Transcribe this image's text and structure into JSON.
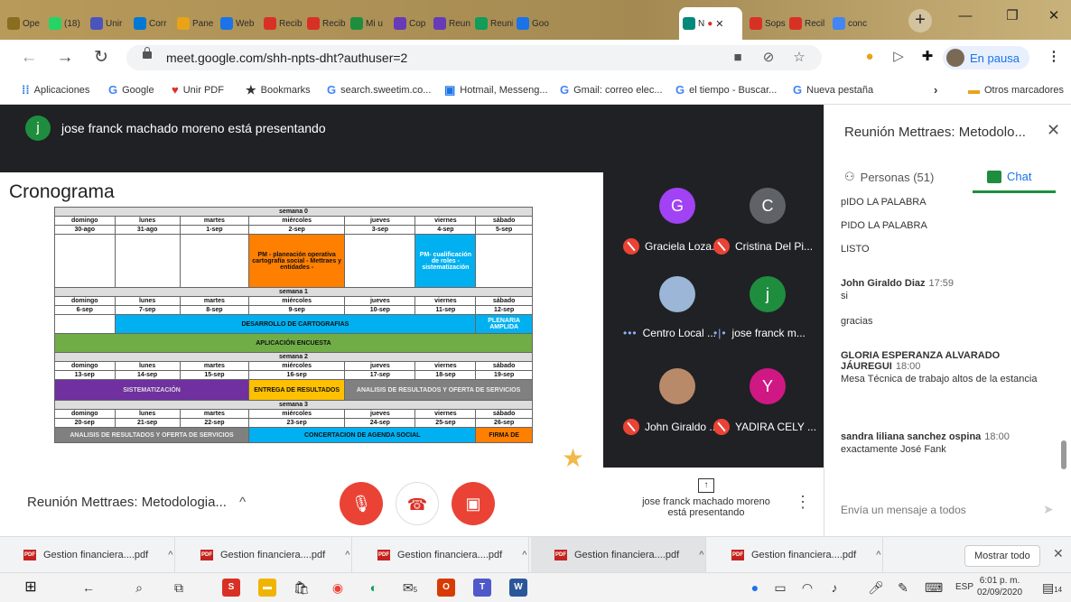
{
  "browser": {
    "tabs": [
      {
        "label": "Ope",
        "icon": "youtube-icon",
        "color": "#8a6d1e"
      },
      {
        "label": "(18) ",
        "icon": "whatsapp-icon",
        "color": "#25d366"
      },
      {
        "label": "Unir",
        "icon": "teams-icon",
        "color": "#4b53bc"
      },
      {
        "label": "Corr",
        "icon": "outlook-icon",
        "color": "#0078d4"
      },
      {
        "label": "Pane",
        "icon": "panel-icon",
        "color": "#e8a317"
      },
      {
        "label": "Web",
        "icon": "web-icon",
        "color": "#1a73e8"
      },
      {
        "label": "Recib",
        "icon": "gmail-icon",
        "color": "#d93025"
      },
      {
        "label": "Recib",
        "icon": "gmail-icon",
        "color": "#d93025"
      },
      {
        "label": "Mi u",
        "icon": "drive-icon",
        "color": "#1e8e3e"
      },
      {
        "label": "Cop",
        "icon": "forms-icon",
        "color": "#673ab7"
      },
      {
        "label": "Reun",
        "icon": "forms-icon",
        "color": "#673ab7"
      },
      {
        "label": "Reuni",
        "icon": "classroom-icon",
        "color": "#0f9d58"
      },
      {
        "label": "Goo",
        "icon": "calendar-icon",
        "color": "#1a73e8"
      },
      {
        "label": "Sops",
        "icon": "gmail-icon",
        "color": "#d93025"
      },
      {
        "label": "Recil",
        "icon": "gmail-icon",
        "color": "#d93025"
      },
      {
        "label": "conc",
        "icon": "google-icon",
        "color": "#4285f4"
      }
    ],
    "active_tab_label": "N",
    "recording_dot": "●",
    "url": "meet.google.com/shh-npts-dht?authuser=2",
    "profile_label": "En pausa"
  },
  "bookmarks": [
    {
      "label": "Aplicaciones",
      "icon": "apps-icon"
    },
    {
      "label": "Google",
      "icon": "google-icon"
    },
    {
      "label": "Unir PDF",
      "icon": "heart-icon"
    },
    {
      "label": "Bookmarks",
      "icon": "star-icon"
    },
    {
      "label": "search.sweetim.co...",
      "icon": "google-icon"
    },
    {
      "label": "Hotmail, Messeng...",
      "icon": "msn-icon"
    },
    {
      "label": "Gmail: correo elec...",
      "icon": "google-icon"
    },
    {
      "label": "el tiempo - Buscar...",
      "icon": "google-icon"
    },
    {
      "label": "Nueva pestaña",
      "icon": "google-icon"
    },
    {
      "label": "Otros marcadores",
      "icon": "folder-icon"
    }
  ],
  "meet": {
    "presenting_avatar": "j",
    "presenting_text": "jose franck machado moreno está presentando",
    "slide": {
      "title": "Cronograma",
      "days_header": [
        "domingo",
        "lunes",
        "martes",
        "miércoles",
        "jueves",
        "viernes",
        "sábado"
      ],
      "weeks": [
        {
          "label": "semana 0",
          "dates": [
            "30-ago",
            "31-ago",
            "1-sep",
            "2-sep",
            "3-sep",
            "4-sep",
            "5-sep"
          ]
        },
        {
          "label": "semana 1",
          "dates": [
            "6-sep",
            "7-sep",
            "8-sep",
            "9-sep",
            "10-sep",
            "11-sep",
            "12-sep"
          ]
        },
        {
          "label": "semana 2",
          "dates": [
            "13-sep",
            "14-sep",
            "15-sep",
            "16-sep",
            "17-sep",
            "18-sep",
            "19-sep"
          ]
        },
        {
          "label": "semana 3",
          "dates": [
            "20-sep",
            "21-sep",
            "22-sep",
            "23-sep",
            "24-sep",
            "25-sep",
            "26-sep"
          ]
        }
      ],
      "activities": {
        "planeacion": "PM - planeación operativa cartografía social - Mettraes y entidades -",
        "cualificacion": "PM- cualificación de roles - sistematización",
        "desarrollo": "DESARROLLO DE CARTOGRAFIAS",
        "plenaria": "PLENARIA AMPLIDA",
        "encuesta": "APLICACIÓN ENCUESTA",
        "sistematizacion": "SISTEMATIZACIÓN",
        "entrega": "ENTREGA DE RESULTADOS",
        "analisis": "ANALISIS DE RESULTADOS Y OFERTA DE SERVICIOS",
        "analisis2": "ANALISIS DE RESULTADOS Y OFERTA DE SERVICIOS",
        "concertacion": "CONCERTACION DE AGENDA SOCIAL",
        "firma": "FIRMA DE"
      },
      "colors": {
        "orange": "#ff7f00",
        "blue": "#00b0f0",
        "green": "#70ad47",
        "purple": "#7030a0",
        "yellow": "#ffc000",
        "gray": "#808080"
      }
    },
    "participants": [
      {
        "initial": "G",
        "name": "Graciela Loza...",
        "color": "#a142f4",
        "status": "muted"
      },
      {
        "initial": "C",
        "name": "Cristina Del Pi...",
        "color": "#5f6368",
        "status": "muted"
      },
      {
        "initial": "",
        "name": "Centro Local ...",
        "color": "#9bb6d6",
        "status": "dots"
      },
      {
        "initial": "j",
        "name": "jose franck m...",
        "color": "#1e8e3e",
        "status": "speaking"
      },
      {
        "initial": "",
        "name": "John Giraldo ...",
        "color": "#b98a6a",
        "status": "muted"
      },
      {
        "initial": "Y",
        "name": "YADIRA CELY ...",
        "color": "#d01884",
        "status": "muted"
      }
    ],
    "meeting_name": "Reunión Mettraes: Metodologia...",
    "present_info": "jose franck machado moreno está presentando",
    "panel": {
      "title": "Reunión Mettraes: Metodolo...",
      "tab_people": "Personas (51)",
      "tab_chat": "Chat",
      "messages": [
        {
          "sender": "",
          "time": "",
          "text": "pIDO LA PALABRA"
        },
        {
          "sender": "",
          "time": "",
          "text": "PIDO LA PALABRA"
        },
        {
          "sender": "",
          "time": "",
          "text": "LISTO"
        },
        {
          "sender": "John Giraldo Diaz",
          "time": "17:59",
          "text": "si"
        },
        {
          "sender": "",
          "time": "",
          "text": "gracias"
        },
        {
          "sender": "GLORIA ESPERANZA ALVARADO JÁUREGUI",
          "time": "18:00",
          "text": "Mesa Técnica de trabajo altos de la estancia"
        },
        {
          "sender": "sandra liliana sanchez ospina",
          "time": "18:00",
          "text": "exactamente José Fank"
        }
      ],
      "input_placeholder": "Envía un mensaje a todos"
    }
  },
  "downloads": {
    "items": [
      "Gestion financiera....pdf",
      "Gestion financiera....pdf",
      "Gestion financiera....pdf",
      "Gestion financiera....pdf",
      "Gestion financiera....pdf"
    ],
    "show_all": "Mostrar todo"
  },
  "taskbar": {
    "language": "ESP",
    "time": "6:01 p. m.",
    "date": "02/09/2020",
    "notification_count": "14",
    "mail_badge": "5"
  }
}
